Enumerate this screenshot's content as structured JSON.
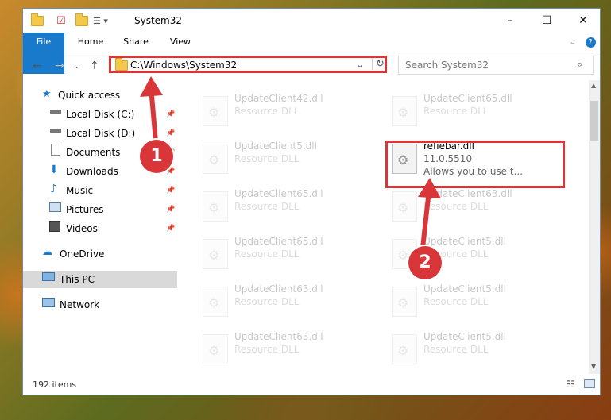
{
  "window": {
    "title": "System32"
  },
  "ribbon": {
    "tabs": [
      "File",
      "Home",
      "Share",
      "View"
    ]
  },
  "address": {
    "path": "C:\\Windows\\System32"
  },
  "search": {
    "placeholder": "Search System32"
  },
  "nav": {
    "quick_access": "Quick access",
    "items": [
      "Local Disk (C:)",
      "Local Disk (D:)",
      "Documents",
      "Downloads",
      "Music",
      "Pictures",
      "Videos"
    ],
    "onedrive": "OneDrive",
    "thispc": "This PC",
    "network": "Network"
  },
  "files": {
    "left": [
      {
        "name": "UpdateClient42.dll",
        "type": "Resource DLL"
      },
      {
        "name": "UpdateClient5.dll",
        "type": "Resource DLL"
      },
      {
        "name": "UpdateClient65.dll",
        "type": "Resource DLL"
      },
      {
        "name": "UpdateClient65.dll",
        "type": "Resource DLL"
      },
      {
        "name": "UpdateClient63.dll",
        "type": "Resource DLL"
      },
      {
        "name": "UpdateClient63.dll",
        "type": "Resource DLL"
      }
    ],
    "right": [
      {
        "name": "UpdateClient65.dll",
        "type": "Resource DLL"
      },
      {
        "name": "refiebar.dll",
        "version": "11.0.5510",
        "desc": "Allows you to use t..."
      },
      {
        "name": "UpdateClient63.dll",
        "type": "Resource DLL"
      },
      {
        "name": "UpdateClient5.dll",
        "type": "Resource DLL"
      },
      {
        "name": "UpdateClient5.dll",
        "type": "Resource DLL"
      },
      {
        "name": "UpdateClient5.dll",
        "type": "Resource DLL"
      }
    ]
  },
  "status": {
    "count": "192 items"
  },
  "callouts": [
    "1",
    "2"
  ]
}
